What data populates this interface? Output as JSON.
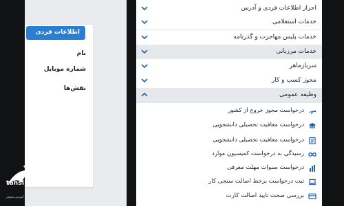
{
  "profile": {
    "header": "اطلاعات فردی",
    "fields": [
      "نام",
      "شماره موبایل",
      "نقش‌ها"
    ]
  },
  "menu": {
    "items": [
      {
        "label": "احراز اطلاعات فردی و آدرس",
        "icon": "chevron-down-icon"
      },
      {
        "label": "خدمات استعلامی",
        "icon": "chevron-down-icon"
      },
      {
        "label": "خدمات پلیس مهاجرت و گذرنامه",
        "icon": "chevron-down-icon"
      },
      {
        "label": "خدمات مرزبانی",
        "icon": "chevron-down-icon",
        "active": true
      },
      {
        "label": "سربازماهر",
        "icon": "chevron-down-icon"
      },
      {
        "label": "مجوز کسب و کار",
        "icon": "chevron-down-icon"
      },
      {
        "label": "وظیفه عمومی",
        "icon": "chevron-up-icon",
        "expanded": true
      }
    ],
    "subitems": [
      {
        "label": "درخواست مجوز خروج از کشور",
        "icon": "airplane-icon"
      },
      {
        "label": "درخواست معافیت تحصیلی دانشجویی",
        "icon": "graduation-icon"
      },
      {
        "label": "درخواست معافیت تحصیلی دانشجویی",
        "icon": "document-list-icon"
      },
      {
        "label": "رسیدگی به درخواست کمیسیون موارد",
        "icon": "infinity-icon"
      },
      {
        "label": "درخواست سنوات مهلت معرفی",
        "icon": "bar-chart-icon"
      },
      {
        "label": "ثبت درخواست برخط اصالت سنجی کار",
        "icon": "laptop-icon"
      },
      {
        "label": "بررسی صحت تایید اصالت کارت",
        "icon": "card-icon"
      }
    ]
  },
  "watermark": {
    "site": "tahsili.co",
    "brand": "تحصیلی",
    "tagline": "مرکز آموزش تحصیلی"
  },
  "colors": {
    "accent": "#2b7fd3",
    "active_row": "#e6e8ec",
    "dark": "#111214"
  }
}
